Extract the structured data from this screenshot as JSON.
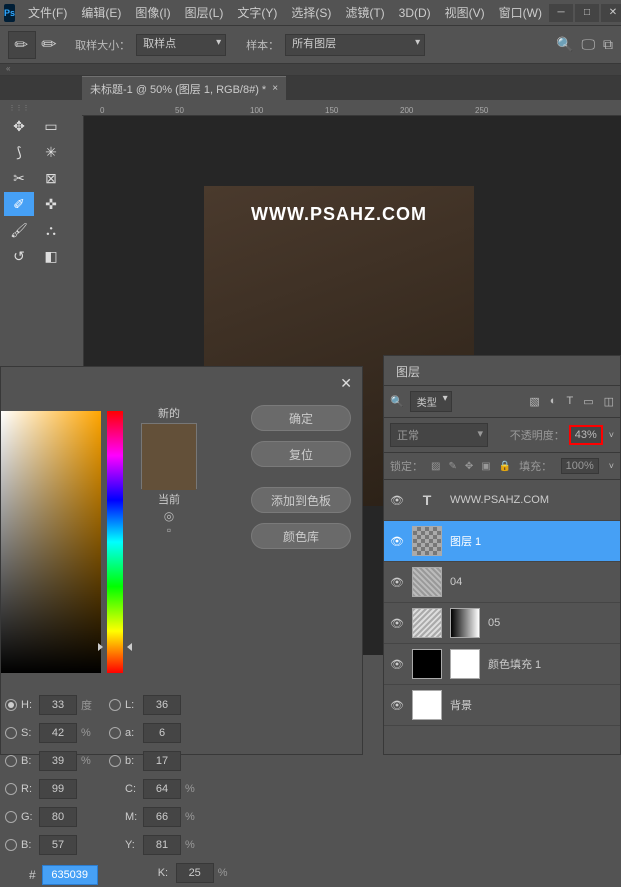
{
  "menu": {
    "items": [
      "文件(F)",
      "编辑(E)",
      "图像(I)",
      "图层(L)",
      "文字(Y)",
      "选择(S)",
      "滤镜(T)",
      "3D(D)",
      "视图(V)",
      "窗口(W)"
    ],
    "logo": "Ps"
  },
  "options": {
    "sampleSizeLabel": "取样大小：",
    "sampleSizeValue": "取样点",
    "sampleLabel": "样本：",
    "sampleValue": "所有图层"
  },
  "docTab": {
    "title": "未标题-1 @ 50% (图层 1, RGB/8#) *"
  },
  "ruler": [
    "0",
    "50",
    "100",
    "150",
    "200",
    "250"
  ],
  "artboard": {
    "text": "WWW.PSAHZ.COM"
  },
  "layers": {
    "title": "图层",
    "filterType": "类型",
    "blendMode": "正常",
    "opacityLabel": "不透明度：",
    "opacityValue": "43%",
    "lockLabel": "锁定：",
    "fillLabel": "填充：",
    "fillValue": "100%",
    "rows": [
      {
        "type": "text",
        "name": "WWW.PSAHZ.COM"
      },
      {
        "type": "checker",
        "name": "图层  1",
        "selected": true
      },
      {
        "type": "tex1",
        "name": "04"
      },
      {
        "type": "tex2",
        "mask": "gradient",
        "name": "05"
      },
      {
        "type": "black",
        "mask": "white",
        "name": "颜色填充 1"
      },
      {
        "type": "white",
        "name": "背景"
      }
    ]
  },
  "colorPicker": {
    "new": "新的",
    "current": "当前",
    "ok": "确定",
    "reset": "复位",
    "addSwatch": "添加到色板",
    "library": "颜色库",
    "H": {
      "lbl": "H:",
      "val": "33",
      "unit": "度"
    },
    "S": {
      "lbl": "S:",
      "val": "42",
      "unit": "%"
    },
    "B": {
      "lbl": "B:",
      "val": "39",
      "unit": "%"
    },
    "R": {
      "lbl": "R:",
      "val": "99"
    },
    "G": {
      "lbl": "G:",
      "val": "80"
    },
    "Bb": {
      "lbl": "B:",
      "val": "57"
    },
    "L": {
      "lbl": "L:",
      "val": "36"
    },
    "a": {
      "lbl": "a:",
      "val": "6"
    },
    "b2": {
      "lbl": "b:",
      "val": "17"
    },
    "C": {
      "lbl": "C:",
      "val": "64",
      "unit": "%"
    },
    "M": {
      "lbl": "M:",
      "val": "66",
      "unit": "%"
    },
    "Y": {
      "lbl": "Y:",
      "val": "81",
      "unit": "%"
    },
    "K": {
      "lbl": "K:",
      "val": "25",
      "unit": "%"
    },
    "hexLabel": "#",
    "hexValue": "635039"
  }
}
